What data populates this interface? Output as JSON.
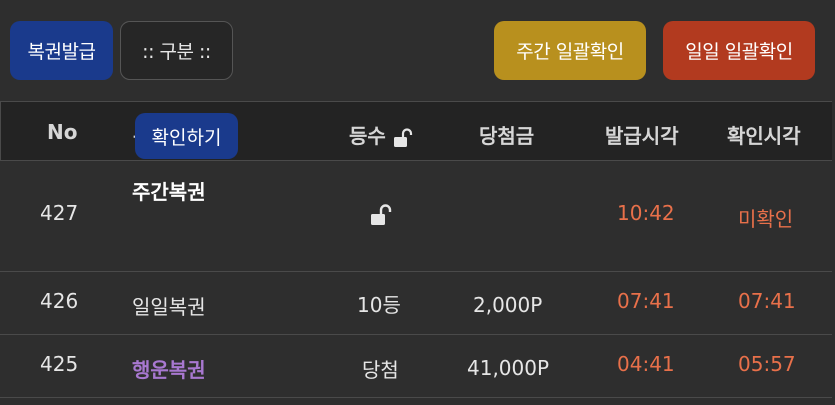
{
  "toolbar": {
    "issue_label": "복권발급",
    "filter_label": ":: 구분 ::",
    "weekly_label": "주간 일괄확인",
    "daily_label": "일일 일괄확인"
  },
  "table": {
    "headers": {
      "no": "No",
      "name": "복권",
      "rank": "등수",
      "prize": "당첨금",
      "issued": "발급시각",
      "confirmed": "확인시각"
    },
    "rows": [
      {
        "no": "427",
        "name": "주간복권",
        "action": "확인하기",
        "rank": "",
        "prize": "",
        "issued": "10:42",
        "confirmed": "미확인"
      },
      {
        "no": "426",
        "name": "일일복권",
        "rank": "10등",
        "prize": "2,000P",
        "issued": "07:41",
        "confirmed": "07:41"
      },
      {
        "no": "425",
        "name": "행운복권",
        "rank": "당첨",
        "prize": "41,000P",
        "issued": "04:41",
        "confirmed": "05:57"
      }
    ]
  },
  "colors": {
    "accent_blue": "#1a3a8c",
    "accent_gold": "#b8901e",
    "accent_red": "#b23a1f",
    "time_orange": "#e8704a",
    "lucky_purple": "#a878d0"
  }
}
